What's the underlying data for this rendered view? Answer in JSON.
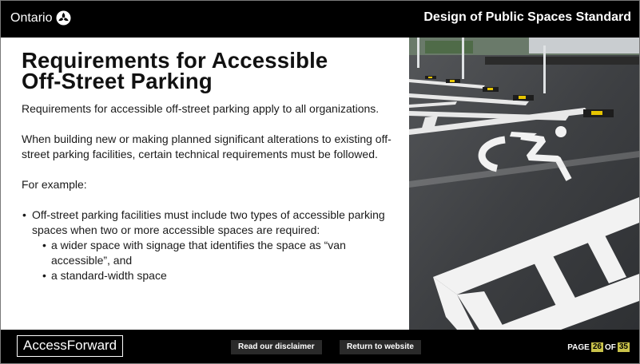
{
  "header": {
    "logo_text": "Ontario",
    "title": "Design of Public Spaces Standard"
  },
  "content": {
    "title_line1": "Requirements for Accessible",
    "title_line2": "Off-Street Parking",
    "paragraph1": "Requirements for accessible off-street parking apply to all organizations.",
    "paragraph2": "When building new or making planned significant alterations to existing off-street parking facilities, certain technical requirements must be followed.",
    "paragraph3": "For example:",
    "bullet1": "Off-street parking facilities must include two types of accessible parking spaces when two or more accessible spaces are required:",
    "subbullet1": "a wider space with signage that identifies the space as “van accessible”, and",
    "subbullet2": "a standard-width space"
  },
  "footer": {
    "brand": "AccessForward",
    "disclaimer_label": "Read our disclaimer",
    "website_label": "Return to website",
    "page_label": "PAGE",
    "page_current": "26",
    "page_of": "OF",
    "page_total": "35"
  },
  "colors": {
    "bar": "#000000",
    "page_badge": "#c9c24a",
    "parking_paint": "#f2f2f2",
    "bumper_yellow": "#e6c400"
  },
  "icons": {
    "logo": "ontario-trillium-icon"
  }
}
